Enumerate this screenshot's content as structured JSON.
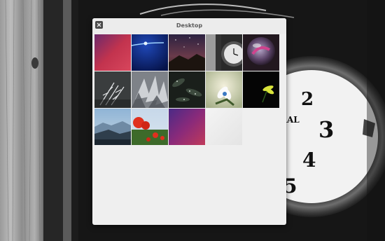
{
  "window": {
    "title": "Desktop",
    "close_icon": "close-icon"
  },
  "wallpapers": [
    {
      "name": "pink-red-gradient"
    },
    {
      "name": "blue-light-streak"
    },
    {
      "name": "night-sky-mountain"
    },
    {
      "name": "clock-bw"
    },
    {
      "name": "crystal-ball"
    },
    {
      "name": "frosted-plant"
    },
    {
      "name": "ice-crystals"
    },
    {
      "name": "dark-foliage-drops"
    },
    {
      "name": "white-flower-bokeh"
    },
    {
      "name": "yellow-flower-dark"
    },
    {
      "name": "coastal-misty-hills"
    },
    {
      "name": "red-poppies-field"
    },
    {
      "name": "purple-gradient"
    },
    {
      "name": "light-gray-blank"
    }
  ]
}
